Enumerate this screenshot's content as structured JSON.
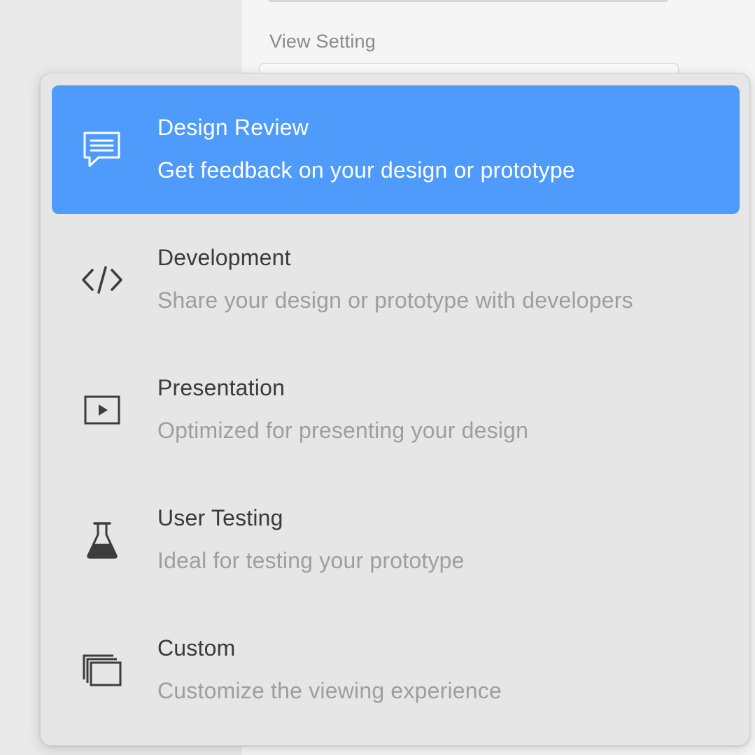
{
  "panel": {
    "label": "View Setting"
  },
  "menu": {
    "items": [
      {
        "icon": "comment-icon",
        "title": "Design Review",
        "description": "Get feedback on your design or prototype",
        "selected": true
      },
      {
        "icon": "code-icon",
        "title": "Development",
        "description": "Share your design or prototype with developers",
        "selected": false
      },
      {
        "icon": "play-icon",
        "title": "Presentation",
        "description": "Optimized for presenting your design",
        "selected": false
      },
      {
        "icon": "flask-icon",
        "title": "User Testing",
        "description": "Ideal for testing your prototype",
        "selected": false
      },
      {
        "icon": "windows-icon",
        "title": "Custom",
        "description": "Customize the viewing experience",
        "selected": false
      }
    ]
  },
  "colors": {
    "selected_bg": "#4e9bfb",
    "menu_bg": "#e6e6e6",
    "title_text": "#3a3a3a",
    "description_text": "#9e9e9e"
  }
}
